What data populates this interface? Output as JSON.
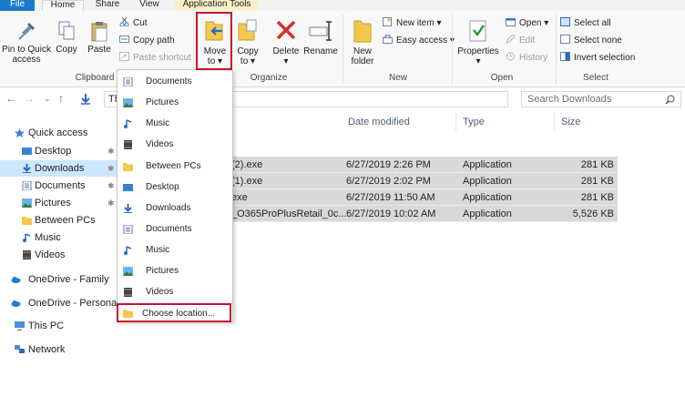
{
  "tabs": {
    "file": "File",
    "home": "Home",
    "share": "Share",
    "view": "View",
    "app_tools": "Application Tools"
  },
  "ribbon": {
    "clipboard": {
      "pin_to_quick_access": "Pin to Quick access",
      "copy": "Copy",
      "paste": "Paste",
      "cut": "Cut",
      "copy_path": "Copy path",
      "paste_shortcut": "Paste shortcut",
      "label": "Clipboard"
    },
    "organize": {
      "move_to_line1": "Move",
      "move_to_line2": "to",
      "copy_to_line1": "Copy",
      "copy_to_line2": "to",
      "delete": "Delete",
      "rename": "Rename",
      "label": "Organize"
    },
    "new": {
      "new_folder_line1": "New",
      "new_folder_line2": "folder",
      "new_item": "New item",
      "easy_access": "Easy access",
      "label": "New"
    },
    "open": {
      "properties": "Properties",
      "open": "Open",
      "edit": "Edit",
      "history": "History",
      "label": "Open"
    },
    "select": {
      "select_all": "Select all",
      "select_none": "Select none",
      "invert_selection": "Invert selection",
      "label": "Select"
    }
  },
  "address": {
    "path_fragment": "Th",
    "search_placeholder": "Search Downloads"
  },
  "nav": {
    "items": [
      {
        "label": "Quick access",
        "icon": "star-icon"
      },
      {
        "label": "Desktop",
        "icon": "desktop-icon"
      },
      {
        "label": "Downloads",
        "icon": "download-icon"
      },
      {
        "label": "Documents",
        "icon": "documents-icon"
      },
      {
        "label": "Pictures",
        "icon": "pictures-icon"
      },
      {
        "label": "Between PCs",
        "icon": "folder-icon"
      },
      {
        "label": "Music",
        "icon": "music-icon"
      },
      {
        "label": "Videos",
        "icon": "videos-icon"
      },
      {
        "label": "OneDrive - Family",
        "icon": "onedrive-icon"
      },
      {
        "label": "OneDrive - Personal",
        "icon": "onedrive-icon"
      },
      {
        "label": "This PC",
        "icon": "pc-icon"
      },
      {
        "label": "Network",
        "icon": "network-icon"
      }
    ]
  },
  "columns": {
    "date_modified": "Date modified",
    "type": "Type",
    "size": "Size"
  },
  "files": [
    {
      "name": "(2).exe",
      "date": "6/27/2019 2:26 PM",
      "type": "Application",
      "size": "281 KB"
    },
    {
      "name": "(1).exe",
      "date": "6/27/2019 2:02 PM",
      "type": "Application",
      "size": "281 KB"
    },
    {
      "name": "exe",
      "date": "6/27/2019 11:50 AM",
      "type": "Application",
      "size": "281 KB"
    },
    {
      "name": "_O365ProPlusRetail_0c...",
      "date": "6/27/2019 10:02 AM",
      "type": "Application",
      "size": "5,526 KB"
    }
  ],
  "move_menu": {
    "items": [
      {
        "label": "Documents",
        "icon": "documents-icon"
      },
      {
        "label": "Pictures",
        "icon": "pictures-icon"
      },
      {
        "label": "Music",
        "icon": "music-icon"
      },
      {
        "label": "Videos",
        "icon": "videos-icon"
      },
      {
        "label": "Between PCs",
        "icon": "folder-icon"
      },
      {
        "label": "Desktop",
        "icon": "desktop-icon"
      },
      {
        "label": "Downloads",
        "icon": "download-icon"
      },
      {
        "label": "Documents",
        "icon": "documents-icon"
      },
      {
        "label": "Music",
        "icon": "music-icon"
      },
      {
        "label": "Pictures",
        "icon": "pictures-icon"
      },
      {
        "label": "Videos",
        "icon": "videos-icon"
      }
    ],
    "choose_location": "Choose location..."
  },
  "colors": {
    "accent": "#1979ca",
    "highlight": "#c8102e",
    "selection": "#cce8ff"
  }
}
